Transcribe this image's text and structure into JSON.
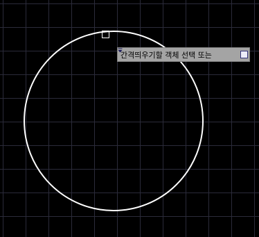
{
  "canvas": {
    "background_color": "#000000",
    "grid_color": "#2b2b3a",
    "circle_color": "#ffffff",
    "grip_color": "#ffffff"
  },
  "prompt_tooltip": {
    "text": "간격띄우기할 객체 선택 또는",
    "background_color": "#a4a4a4",
    "dropdown_icon": "arrow-down-icon"
  }
}
